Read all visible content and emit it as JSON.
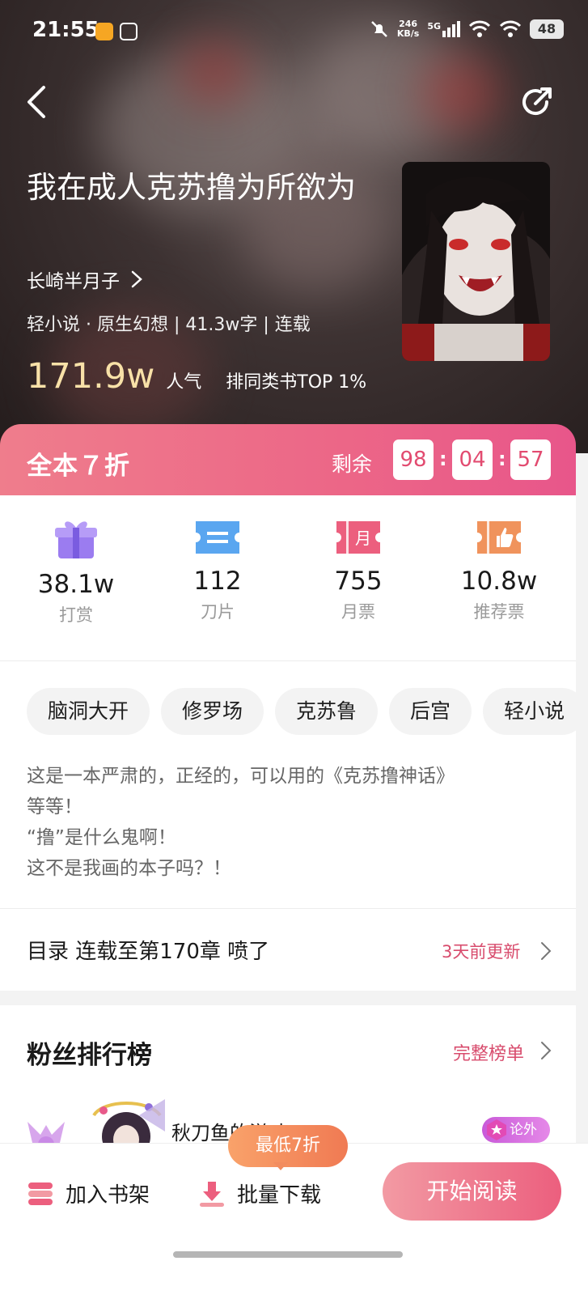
{
  "status_bar": {
    "time": "21:55",
    "net_speed": "246",
    "net_unit": "KB/s",
    "signal_label": "5G",
    "battery": "48"
  },
  "book": {
    "title": "我在成人克苏撸为所欲为",
    "author": "长崎半月子",
    "meta": "轻小说 · 原生幻想 | 41.3w字 | 连载",
    "popularity": "171.9w",
    "popularity_label": "人气",
    "rank": "排同类书TOP 1%"
  },
  "discount": {
    "label": "全本７折",
    "remaining_label": "剩余",
    "hours": "98",
    "minutes": "04",
    "seconds": "57"
  },
  "stats": [
    {
      "value": "38.1w",
      "label": "打赏",
      "icon": "gift-icon"
    },
    {
      "value": "112",
      "label": "刀片",
      "icon": "blade-ticket-icon"
    },
    {
      "value": "755",
      "label": "月票",
      "icon": "monthly-ticket-icon"
    },
    {
      "value": "10.8w",
      "label": "推荐票",
      "icon": "thumbs-up-ticket-icon"
    }
  ],
  "tags": [
    "脑洞大开",
    "修罗场",
    "克苏鲁",
    "后宫",
    "轻小说"
  ],
  "description": [
    "这是一本严肃的，正经的，可以用的《克苏撸神话》",
    "等等！",
    "“撸”是什么鬼啊！",
    "这不是我画的本子吗？！"
  ],
  "toc": {
    "label": "目录 连载至第170章 喷了",
    "updated": "3天前更新"
  },
  "fans": {
    "title": "粉丝排行榜",
    "full_list": "完整榜单",
    "top_fan_name": "秋刀鱼的滋味",
    "top_fan_badge": "论外"
  },
  "bottom_bar": {
    "add_shelf": "加入书架",
    "batch_download": "批量下载",
    "low_price_badge": "最低7折",
    "start_reading": "开始阅读"
  },
  "colors": {
    "accent": "#ec6687",
    "link_red": "#d84c6d",
    "popularity_gold": "#f8e1a8"
  }
}
